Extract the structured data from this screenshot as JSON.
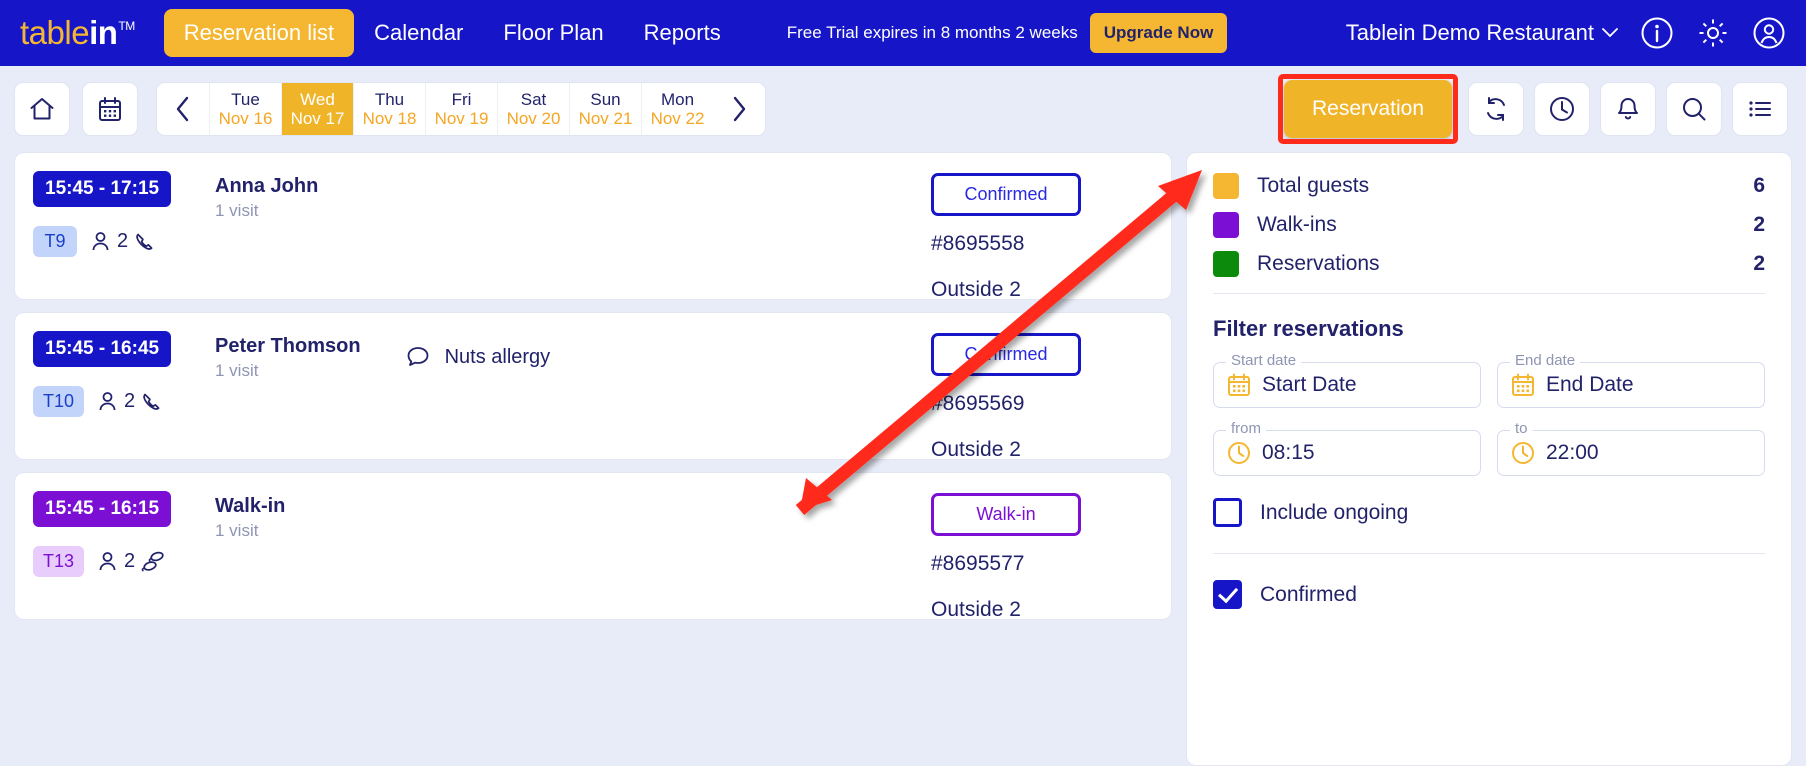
{
  "header": {
    "logo": {
      "part1": "table",
      "part2": "in",
      "tm": "TM"
    },
    "nav": [
      {
        "label": "Reservation list",
        "active": true
      },
      {
        "label": "Calendar",
        "active": false
      },
      {
        "label": "Floor Plan",
        "active": false
      },
      {
        "label": "Reports",
        "active": false
      }
    ],
    "trial_text": "Free Trial expires in 8 months 2 weeks",
    "upgrade_label": "Upgrade Now",
    "restaurant_name": "Tablein Demo Restaurant",
    "icons": [
      "info-icon",
      "gear-icon",
      "account-icon"
    ]
  },
  "toolbar": {
    "home_icon": "home-icon",
    "calendar_icon": "calendar-icon",
    "prev_icon": "chevron-left-icon",
    "next_icon": "chevron-right-icon",
    "days": [
      {
        "dow": "Tue",
        "dom": "Nov 16",
        "active": false
      },
      {
        "dow": "Wed",
        "dom": "Nov 17",
        "active": true
      },
      {
        "dow": "Thu",
        "dom": "Nov 18",
        "active": false
      },
      {
        "dow": "Fri",
        "dom": "Nov 19",
        "active": false
      },
      {
        "dow": "Sat",
        "dom": "Nov 20",
        "active": false
      },
      {
        "dow": "Sun",
        "dom": "Nov 21",
        "active": false
      },
      {
        "dow": "Mon",
        "dom": "Nov 22",
        "active": false
      }
    ],
    "reservation_label": "Reservation",
    "highlight_color": "#ff2b1a",
    "right_icons": [
      "refresh-icon",
      "clock-icon",
      "bell-icon",
      "search-icon",
      "list-icon"
    ]
  },
  "reservations": [
    {
      "time": "15:45 - 17:15",
      "time_color": "#1616c8",
      "table": "T9",
      "guests": "2",
      "contact_icon": "phone-icon",
      "name": "Anna John",
      "visits": "1 visit",
      "note": "",
      "status": "Confirmed",
      "status_color": "#1616c8",
      "number": "#8695558",
      "area": "Outside 2"
    },
    {
      "time": "15:45 - 16:45",
      "time_color": "#1616c8",
      "table": "T10",
      "guests": "2",
      "contact_icon": "phone-icon",
      "name": "Peter Thomson",
      "visits": "1 visit",
      "note": "Nuts allergy",
      "status": "Confirmed",
      "status_color": "#1616c8",
      "number": "#8695569",
      "area": "Outside 2"
    },
    {
      "time": "15:45 - 16:15",
      "time_color": "#7b0fd4",
      "table": "T13",
      "guests": "2",
      "contact_icon": "footprints-icon",
      "name": "Walk-in",
      "visits": "1 visit",
      "note": "",
      "status": "Walk-in",
      "status_color": "#7b0fd4",
      "number": "#8695577",
      "area": "Outside 2"
    }
  ],
  "sidebar": {
    "stats": [
      {
        "label": "Total guests",
        "value": "6",
        "color": "#f5b731"
      },
      {
        "label": "Walk-ins",
        "value": "2",
        "color": "#7b0fd4"
      },
      {
        "label": "Reservations",
        "value": "2",
        "color": "#0b8a0b"
      }
    ],
    "filter_title": "Filter reservations",
    "start_date": {
      "label": "Start date",
      "value": "Start Date",
      "icon": "calendar-icon"
    },
    "end_date": {
      "label": "End date",
      "value": "End Date",
      "icon": "calendar-icon"
    },
    "from_time": {
      "label": "from",
      "value": "08:15",
      "icon": "clock-icon"
    },
    "to_time": {
      "label": "to",
      "value": "22:00",
      "icon": "clock-icon"
    },
    "include_ongoing": {
      "label": "Include ongoing",
      "checked": false
    },
    "confirmed": {
      "label": "Confirmed",
      "checked": true
    }
  }
}
